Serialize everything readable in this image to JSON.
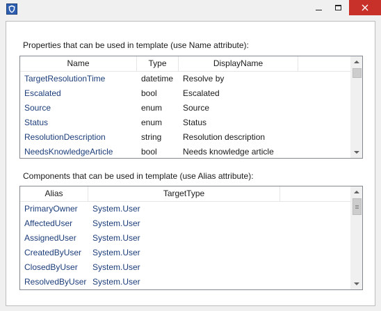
{
  "window": {
    "icon": "app-shield-icon",
    "controls": [
      "minimize-icon",
      "maximize-icon",
      "close-icon"
    ],
    "close_glyph": "✕"
  },
  "properties": {
    "label": "Properties that can be used in template (use Name attribute):",
    "columns": [
      "Name",
      "Type",
      "DisplayName",
      ""
    ],
    "rows": [
      [
        "TargetResolutionTime",
        "datetime",
        "Resolve by"
      ],
      [
        "Escalated",
        "bool",
        "Escalated"
      ],
      [
        "Source",
        "enum",
        "Source"
      ],
      [
        "Status",
        "enum",
        "Status"
      ],
      [
        "ResolutionDescription",
        "string",
        "Resolution description"
      ],
      [
        "NeedsKnowledgeArticle",
        "bool",
        "Needs knowledge article"
      ]
    ]
  },
  "components": {
    "label": "Components that can be used in template (use Alias attribute):",
    "columns": [
      "Alias",
      "TargetType",
      ""
    ],
    "rows": [
      [
        "PrimaryOwner",
        "System.User"
      ],
      [
        "AffectedUser",
        "System.User"
      ],
      [
        "AssignedUser",
        "System.User"
      ],
      [
        "CreatedByUser",
        "System.User"
      ],
      [
        "ClosedByUser",
        "System.User"
      ],
      [
        "ResolvedByUser",
        "System.User"
      ]
    ]
  },
  "colors": {
    "close_button": "#c7312a",
    "item_text": "#1c3d7a",
    "icon_blue": "#2e5fb0"
  }
}
